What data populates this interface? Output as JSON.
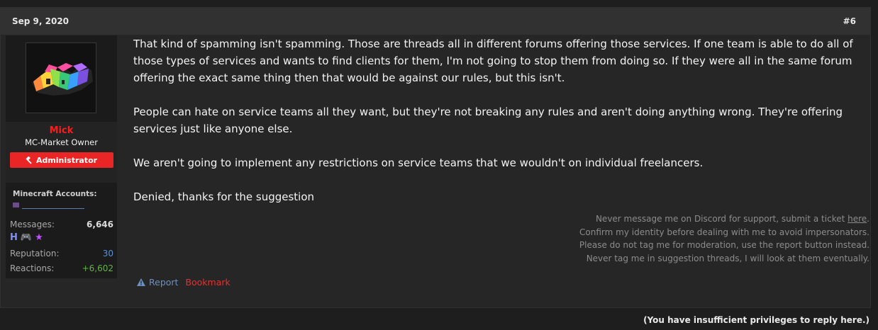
{
  "post": {
    "date": "Sep 9, 2020",
    "number": "#6",
    "paragraphs": [
      "That kind of spamming isn't spamming. Those are threads all in different forums offering those services. If one team is able to do all of those types of services and wants to find clients for them, I'm not going to stop them from doing so. If they were all in the same forum offering the exact same thing then that would be against our rules, but this isn't.",
      "People can hate on service teams all they want, but they're not breaking any rules and aren't doing anything wrong. They're offering services just like anyone else.",
      "We aren't going to implement any restrictions on service teams that we wouldn't on individual freelancers.",
      "Denied, thanks for the suggestion"
    ],
    "signature": {
      "line1_prefix": "Never message me on Discord for support, submit a ticket ",
      "line1_link": "here",
      "line1_suffix": ".",
      "line2": "Confirm my identity before dealing with me to avoid impersonators.",
      "line3": "Please do not tag me for moderation, use the report button instead.",
      "line4": "Never tag me in suggestion threads, I will look at them eventually."
    },
    "actions": {
      "report": "Report",
      "bookmark": "Bookmark"
    }
  },
  "user": {
    "name": "Mick",
    "title": "MC-Market Owner",
    "role": "Administrator",
    "minecraft_label": "Minecraft Accounts:",
    "stats": {
      "messages_label": "Messages:",
      "messages_value": "6,646",
      "reputation_label": "Reputation:",
      "reputation_value": "30",
      "reactions_label": "Reactions:",
      "reactions_value": "+6,602"
    },
    "trophies": [
      "H",
      "🎮",
      "★"
    ]
  },
  "footer": {
    "note": "(You have insufficient privileges to reply here.)"
  },
  "colors": {
    "accent_red": "#ea2525",
    "username_red": "#ff1a1a",
    "link_blue": "#5b90d6",
    "reactions_green": "#63b347"
  },
  "icons": {
    "role": "hammer-icon",
    "report": "warning-icon"
  }
}
